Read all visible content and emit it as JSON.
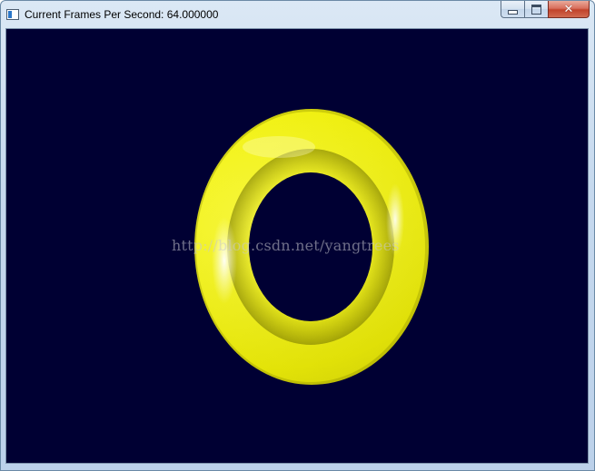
{
  "window": {
    "title": "Current Frames Per Second: 64.000000",
    "controls": {
      "minimize_icon": "minimize-icon",
      "maximize_icon": "maximize-icon",
      "close_icon": "close-icon"
    }
  },
  "scene": {
    "background_color": "#000033",
    "object": "torus",
    "object_color": "#ffff00",
    "watermark": "http://blog.csdn.net/yangtrees"
  }
}
